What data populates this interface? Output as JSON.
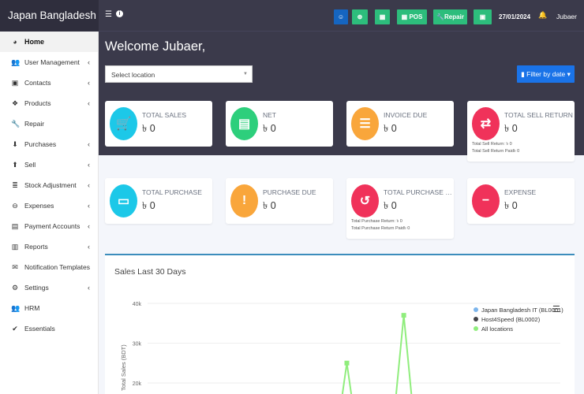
{
  "brand": "Japan Bangladesh IT",
  "header": {
    "menu_icon": "hamburger-icon",
    "info_icon": "info-icon",
    "pos_label": "POS",
    "repair_label": "Repair",
    "date": "27/01/2024",
    "user": "Jubaer"
  },
  "sidebar": {
    "items": [
      {
        "label": "Home",
        "icon": "tachometer-icon",
        "glyph": "◕",
        "chev": false
      },
      {
        "label": "User Management",
        "icon": "users-icon",
        "glyph": "👥",
        "chev": true
      },
      {
        "label": "Contacts",
        "icon": "address-book-icon",
        "glyph": "▣",
        "chev": true
      },
      {
        "label": "Products",
        "icon": "cubes-icon",
        "glyph": "❖",
        "chev": true
      },
      {
        "label": "Repair",
        "icon": "wrench-icon",
        "glyph": "🔧",
        "chev": false
      },
      {
        "label": "Purchases",
        "icon": "arrow-circle-down-icon",
        "glyph": "⬇",
        "chev": true
      },
      {
        "label": "Sell",
        "icon": "arrow-circle-up-icon",
        "glyph": "⬆",
        "chev": true
      },
      {
        "label": "Stock Adjustment",
        "icon": "database-icon",
        "glyph": "≣",
        "chev": true
      },
      {
        "label": "Expenses",
        "icon": "minus-circle-icon",
        "glyph": "⊖",
        "chev": true
      },
      {
        "label": "Payment Accounts",
        "icon": "money-icon",
        "glyph": "▤",
        "chev": true
      },
      {
        "label": "Reports",
        "icon": "bar-chart-icon",
        "glyph": "▥",
        "chev": true
      },
      {
        "label": "Notification Templates",
        "icon": "envelope-icon",
        "glyph": "✉",
        "chev": false
      },
      {
        "label": "Settings",
        "icon": "cog-icon",
        "glyph": "⚙",
        "chev": true
      },
      {
        "label": "HRM",
        "icon": "users-icon",
        "glyph": "👥",
        "chev": false
      },
      {
        "label": "Essentials",
        "icon": "check-circle-icon",
        "glyph": "✔",
        "chev": false
      }
    ]
  },
  "main": {
    "welcome": "Welcome Jubaer,",
    "location_placeholder": "Select location",
    "filter_label": "Filter by date"
  },
  "cards": [
    {
      "label": "TOTAL SALES",
      "value": "৳ 0",
      "color": "#1cc8e8",
      "glyph": "🛒"
    },
    {
      "label": "NET",
      "value": "৳ 0",
      "color": "#2dcf7c",
      "glyph": "▤"
    },
    {
      "label": "INVOICE DUE",
      "value": "৳ 0",
      "color": "#f9a63b",
      "glyph": "☰"
    },
    {
      "label": "TOTAL SELL RETURN",
      "value": "৳ 0",
      "color": "#f0325a",
      "glyph": "⇄",
      "sub": [
        "Total Sell Return: ৳ 0",
        "Total Sell Return Paid৳ 0"
      ]
    },
    {
      "label": "TOTAL PURCHASE",
      "value": "৳ 0",
      "color": "#1cc8e8",
      "glyph": "▭"
    },
    {
      "label": "PURCHASE DUE",
      "value": "৳ 0",
      "color": "#f9a63b",
      "glyph": "!"
    },
    {
      "label": "TOTAL PURCHASE RETURN",
      "value": "৳ 0",
      "color": "#f0325a",
      "glyph": "↺",
      "sub": [
        "Total Purchase Return: ৳ 0",
        "Total Purchase Return Paid৳ 0"
      ]
    },
    {
      "label": "EXPENSE",
      "value": "৳ 0",
      "color": "#f0325a",
      "glyph": "−"
    }
  ],
  "chart_data": {
    "type": "line",
    "title": "Sales Last 30 Days",
    "ylabel": "Total Sales (BDT)",
    "yticks": [
      "20k",
      "30k",
      "40k"
    ],
    "ylim": [
      0,
      40000
    ],
    "legend_position": "top-right",
    "series": [
      {
        "name": "Japan Bangladesh IT (BL0001)",
        "color": "#7cb5ec",
        "values": [
          0,
          0,
          0,
          0,
          0,
          0,
          0,
          0,
          0,
          0,
          0,
          0,
          0,
          0,
          0,
          0,
          0,
          0,
          0,
          0,
          0,
          0,
          0,
          0,
          0,
          0,
          0,
          0,
          0,
          0
        ]
      },
      {
        "name": "Host4Speed (BL0002)",
        "color": "#434348",
        "values": [
          0,
          0,
          0,
          0,
          0,
          0,
          0,
          0,
          0,
          0,
          0,
          0,
          0,
          0,
          0,
          0,
          0,
          0,
          0,
          0,
          0,
          0,
          0,
          0,
          0,
          0,
          0,
          0,
          0,
          0
        ]
      },
      {
        "name": "All locations",
        "color": "#90ed7d",
        "values": [
          0,
          0,
          0,
          0,
          0,
          0,
          0,
          0,
          0,
          0,
          0,
          0,
          0,
          0,
          25000,
          0,
          0,
          0,
          37000,
          0,
          0,
          0,
          0,
          0,
          0,
          0,
          0,
          0,
          0,
          0
        ]
      }
    ]
  }
}
